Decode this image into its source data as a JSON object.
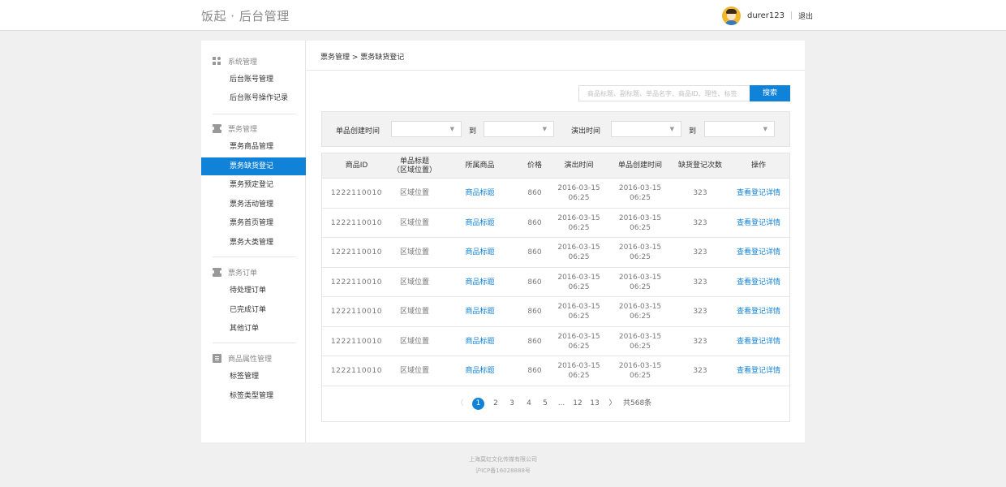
{
  "header": {
    "logo": "饭起 · 后台管理",
    "username": "durer123",
    "logout": "退出"
  },
  "sidebar": {
    "groups": [
      {
        "title": "系统管理",
        "icon": "grid-icon",
        "items": [
          "后台账号管理",
          "后台账号操作记录"
        ]
      },
      {
        "title": "票务管理",
        "icon": "ticket-icon",
        "items": [
          "票务商品管理",
          "票务缺货登记",
          "票务预定登记",
          "票务活动管理",
          "票务首页管理",
          "票务大类管理"
        ]
      },
      {
        "title": "票务订单",
        "icon": "ticket-order-icon",
        "items": [
          "待处理订单",
          "已完成订单",
          "其他订单"
        ]
      },
      {
        "title": "商品属性管理",
        "icon": "list-icon",
        "items": [
          "标签管理",
          "标签类型管理"
        ]
      }
    ],
    "active": "票务缺货登记"
  },
  "breadcrumb": "票务管理 > 票务缺货登记",
  "search": {
    "placeholder": "商品标题、副标题、单品名字、商品ID、理性、标签",
    "button": "搜索"
  },
  "filters": {
    "created_label": "单品创建时间",
    "to1": "到",
    "show_label": "演出时间",
    "to2": "到",
    "arrow": "▼"
  },
  "table": {
    "headers": [
      "商品ID",
      "单品标题",
      "（区域位置）",
      "所属商品",
      "价格",
      "演出时间",
      "单品创建时间",
      "缺货登记次数",
      "操作"
    ],
    "rows": [
      {
        "id": "1222110010",
        "title": "区域位置",
        "product": "商品标题",
        "price": "860",
        "show_date": "2016-03-15",
        "show_time": "06:25",
        "create_date": "2016-03-15",
        "create_time": "06:25",
        "count": "323",
        "action": "查看登记详情"
      },
      {
        "id": "1222110010",
        "title": "区域位置",
        "product": "商品标题",
        "price": "860",
        "show_date": "2016-03-15",
        "show_time": "06:25",
        "create_date": "2016-03-15",
        "create_time": "06:25",
        "count": "323",
        "action": "查看登记详情"
      },
      {
        "id": "1222110010",
        "title": "区域位置",
        "product": "商品标题",
        "price": "860",
        "show_date": "2016-03-15",
        "show_time": "06:25",
        "create_date": "2016-03-15",
        "create_time": "06:25",
        "count": "323",
        "action": "查看登记详情"
      },
      {
        "id": "1222110010",
        "title": "区域位置",
        "product": "商品标题",
        "price": "860",
        "show_date": "2016-03-15",
        "show_time": "06:25",
        "create_date": "2016-03-15",
        "create_time": "06:25",
        "count": "323",
        "action": "查看登记详情"
      },
      {
        "id": "1222110010",
        "title": "区域位置",
        "product": "商品标题",
        "price": "860",
        "show_date": "2016-03-15",
        "show_time": "06:25",
        "create_date": "2016-03-15",
        "create_time": "06:25",
        "count": "323",
        "action": "查看登记详情"
      },
      {
        "id": "1222110010",
        "title": "区域位置",
        "product": "商品标题",
        "price": "860",
        "show_date": "2016-03-15",
        "show_time": "06:25",
        "create_date": "2016-03-15",
        "create_time": "06:25",
        "count": "323",
        "action": "查看登记详情"
      },
      {
        "id": "1222110010",
        "title": "区域位置",
        "product": "商品标题",
        "price": "860",
        "show_date": "2016-03-15",
        "show_time": "06:25",
        "create_date": "2016-03-15",
        "create_time": "06:25",
        "count": "323",
        "action": "查看登记详情"
      }
    ]
  },
  "pagination": {
    "prev": "〈",
    "pages": [
      "1",
      "2",
      "3",
      "4",
      "5",
      "...",
      "12",
      "13"
    ],
    "current": "1",
    "next": "〉",
    "total": "共568条"
  },
  "footer": {
    "company": "上海莫虹文化传媒有限公司",
    "icp": "沪ICP备16028888号"
  },
  "colors": {
    "accent": "#1083d8",
    "background": "#f0f0f0"
  }
}
